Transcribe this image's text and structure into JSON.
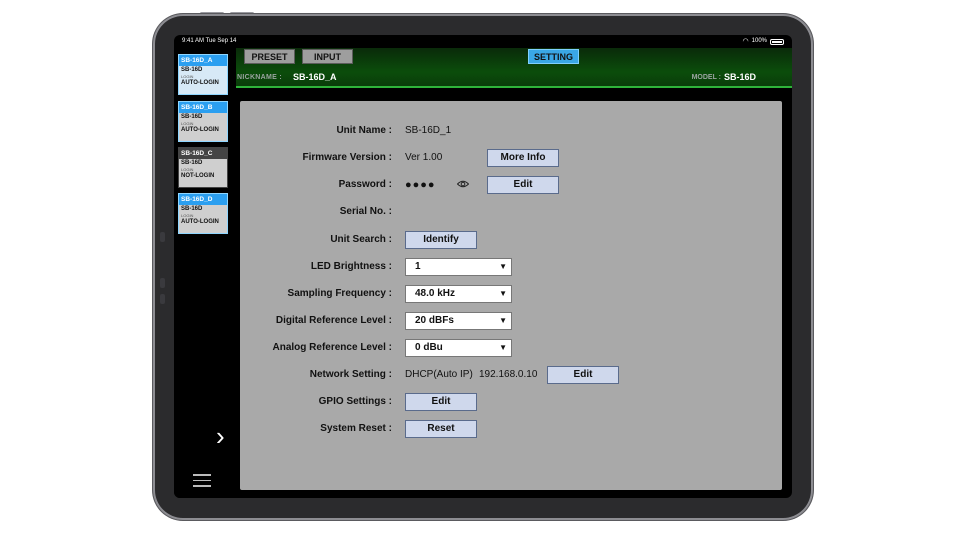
{
  "status_bar": {
    "time": "9:41 AM  Tue Sep 14",
    "battery": "100%"
  },
  "tabs": [
    {
      "label": "PRESET"
    },
    {
      "label": "INPUT"
    },
    {
      "label": "SETTING"
    }
  ],
  "header": {
    "nickname_label": "NICKNAME :",
    "nickname_value": "SB-16D_A",
    "model_label": "MODEL :",
    "model_value": "SB-16D"
  },
  "units": [
    {
      "name": "SB-16D_A",
      "model": "SB-16D",
      "login_caption": "LOGIN",
      "status": "AUTO-LOGIN"
    },
    {
      "name": "SB-16D_B",
      "model": "SB-16D",
      "login_caption": "LOGIN",
      "status": "AUTO-LOGIN"
    },
    {
      "name": "SB-16D_C",
      "model": "SB-16D",
      "login_caption": "LOGIN",
      "status": "NOT-LOGIN"
    },
    {
      "name": "SB-16D_D",
      "model": "SB-16D",
      "login_caption": "LOGIN",
      "status": "AUTO-LOGIN"
    }
  ],
  "settings": {
    "unit_name": {
      "label": "Unit Name :",
      "value": "SB-16D_1"
    },
    "firmware": {
      "label": "Firmware Version :",
      "value": "Ver 1.00",
      "button": "More Info"
    },
    "password": {
      "label": "Password :",
      "value": "●●●●",
      "button": "Edit"
    },
    "serial": {
      "label": "Serial No. :",
      "value": ""
    },
    "unit_search": {
      "label": "Unit Search :",
      "button": "Identify"
    },
    "led_brightness": {
      "label": "LED Brightness :",
      "selected": "1"
    },
    "sampling_frequency": {
      "label": "Sampling Frequency :",
      "selected": "48.0 kHz"
    },
    "digital_ref": {
      "label": "Digital Reference Level :",
      "selected": "20 dBFs"
    },
    "analog_ref": {
      "label": "Analog Reference Level :",
      "selected": "0 dBu"
    },
    "network": {
      "label": "Network Setting :",
      "mode": "DHCP(Auto IP)",
      "ip": "192.168.0.10",
      "button": "Edit"
    },
    "gpio": {
      "label": "GPIO Settings :",
      "button": "Edit"
    },
    "system_reset": {
      "label": "System Reset :",
      "button": "Reset"
    }
  },
  "colors": {
    "accent": "#3aa7e6",
    "active_unit": "#2b9ff0",
    "panel": "#a9a9a9",
    "header_green": "#0b4d0b"
  }
}
